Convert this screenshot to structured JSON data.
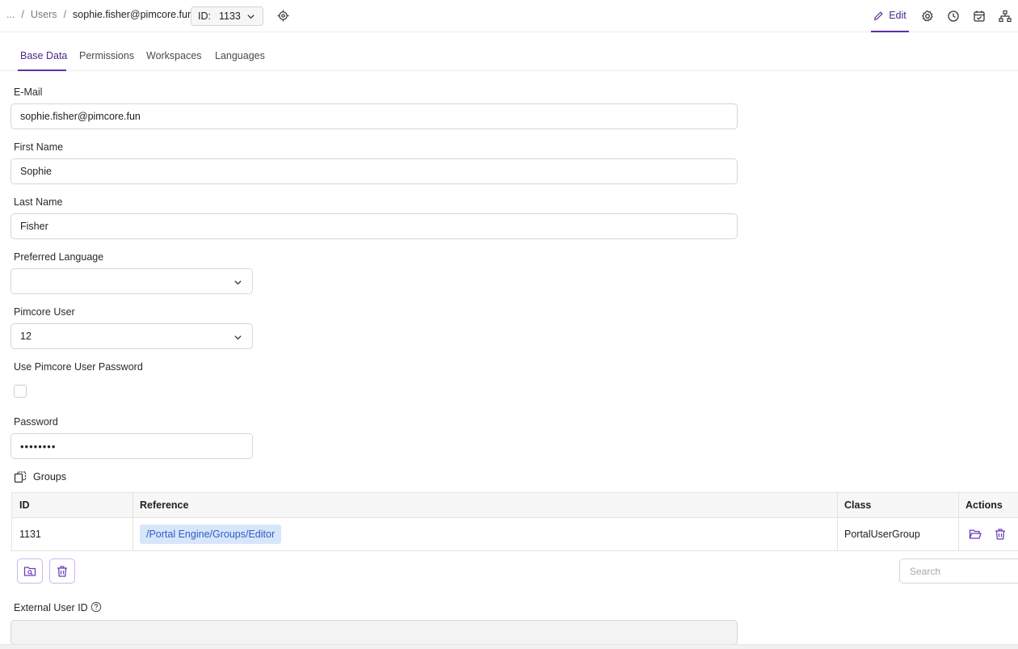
{
  "breadcrumb": {
    "ellipsis": "...",
    "parent": "Users",
    "current": "sophie.fisher@pimcore.fun"
  },
  "id_selector": {
    "label": "ID:",
    "value": "1133"
  },
  "toolbar": {
    "edit_label": "Edit"
  },
  "tabs": [
    {
      "label": "Base Data",
      "active": true
    },
    {
      "label": "Permissions"
    },
    {
      "label": "Workspaces"
    },
    {
      "label": "Languages"
    }
  ],
  "form": {
    "email": {
      "label": "E-Mail",
      "value": "sophie.fisher@pimcore.fun"
    },
    "first_name": {
      "label": "First Name",
      "value": "Sophie"
    },
    "last_name": {
      "label": "Last Name",
      "value": "Fisher"
    },
    "preferred_language": {
      "label": "Preferred Language",
      "value": ""
    },
    "pimcore_user": {
      "label": "Pimcore User",
      "value": "12"
    },
    "use_pimcore_password": {
      "label": "Use Pimcore User Password",
      "checked": false
    },
    "password": {
      "label": "Password",
      "value": "••••••••"
    },
    "external_user_id": {
      "label": "External User ID",
      "value": ""
    }
  },
  "groups": {
    "title": "Groups",
    "columns": [
      "ID",
      "Reference",
      "Class",
      "Actions"
    ],
    "rows": [
      {
        "id": "1131",
        "reference": "/Portal Engine/Groups/Editor",
        "class": "PortalUserGroup"
      }
    ],
    "search_placeholder": "Search"
  },
  "colors": {
    "accent": "#5e2fa7",
    "reference_tag_bg": "#d8e6fb",
    "reference_tag_text": "#2c5ec4"
  },
  "icons": [
    "target-icon",
    "pencil-icon",
    "gear-icon",
    "history-icon",
    "calendar-check-icon",
    "hierarchy-icon",
    "copy-icon",
    "folder-open-icon",
    "trash-icon",
    "folder-search-icon",
    "help-icon",
    "chevron-down-icon"
  ]
}
